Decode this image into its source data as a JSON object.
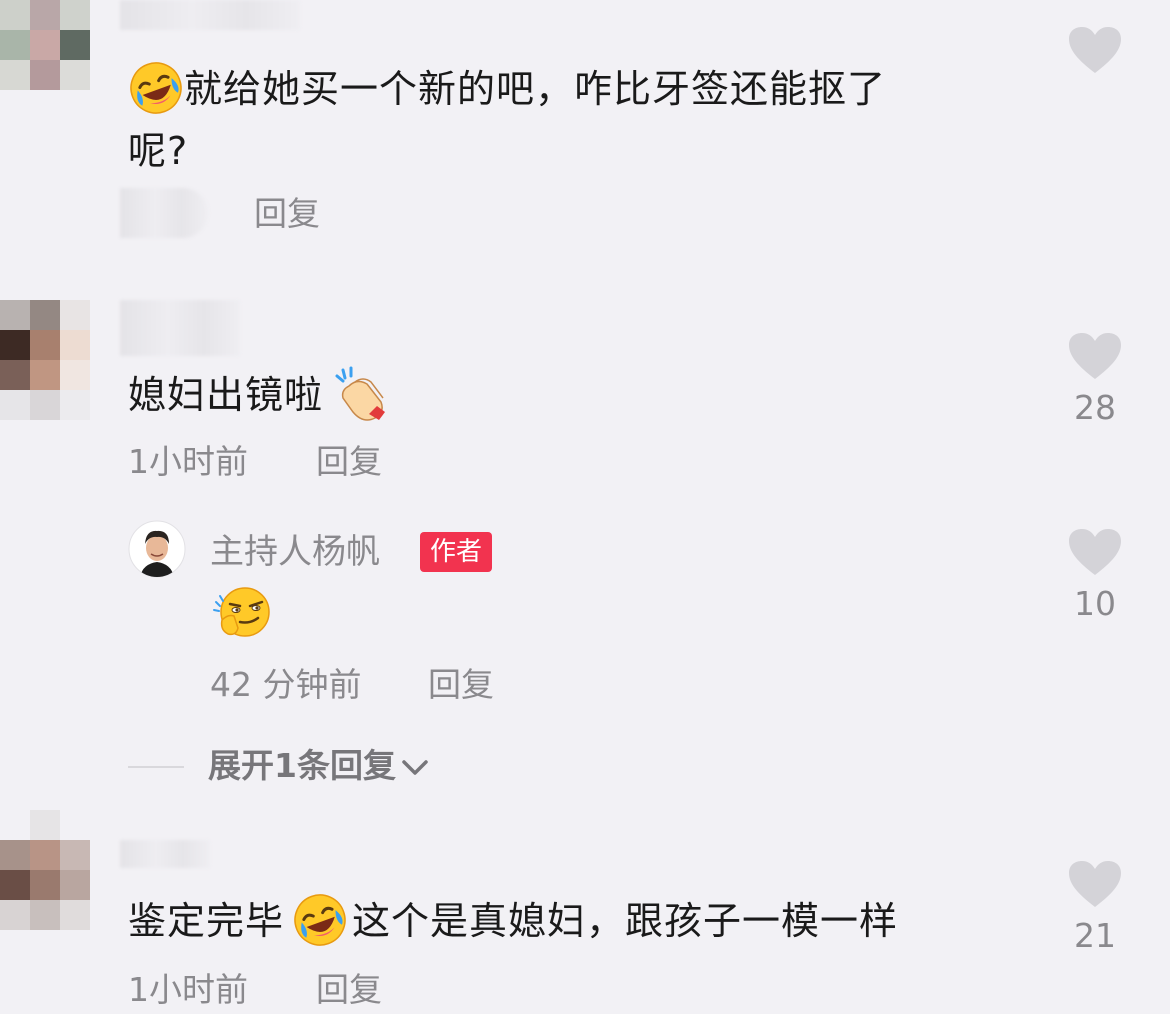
{
  "comments": [
    {
      "text_line1": "就给她买一个新的吧，咋比牙签还能抠了",
      "text_line2": "呢?",
      "reply_label": "回复"
    },
    {
      "text": "媳妇出镜啦",
      "time": "1小时前",
      "reply_label": "回复",
      "likes": "28",
      "author_reply": {
        "name": "主持人杨帆",
        "badge": "作者",
        "time": "42 分钟前",
        "reply_label": "回复",
        "likes": "10"
      },
      "expand_label": "展开1条回复"
    },
    {
      "text_before": "鉴定完毕",
      "text_after": "这个是真媳妇，跟孩子一模一样",
      "time": "1小时前",
      "reply_label": "回复",
      "likes": "21"
    }
  ],
  "icons": {
    "like": "heart-icon",
    "laugh": "rolling-laugh-emoji",
    "clap": "clapping-hands-emoji",
    "thinking": "smirk-thinking-emoji",
    "expand": "chevron-down-icon"
  },
  "colors": {
    "background": "#f2f1f5",
    "text": "#1a1a1a",
    "meta": "#8a898d",
    "heart": "#d4d3d8",
    "badge": "#f2334f"
  }
}
